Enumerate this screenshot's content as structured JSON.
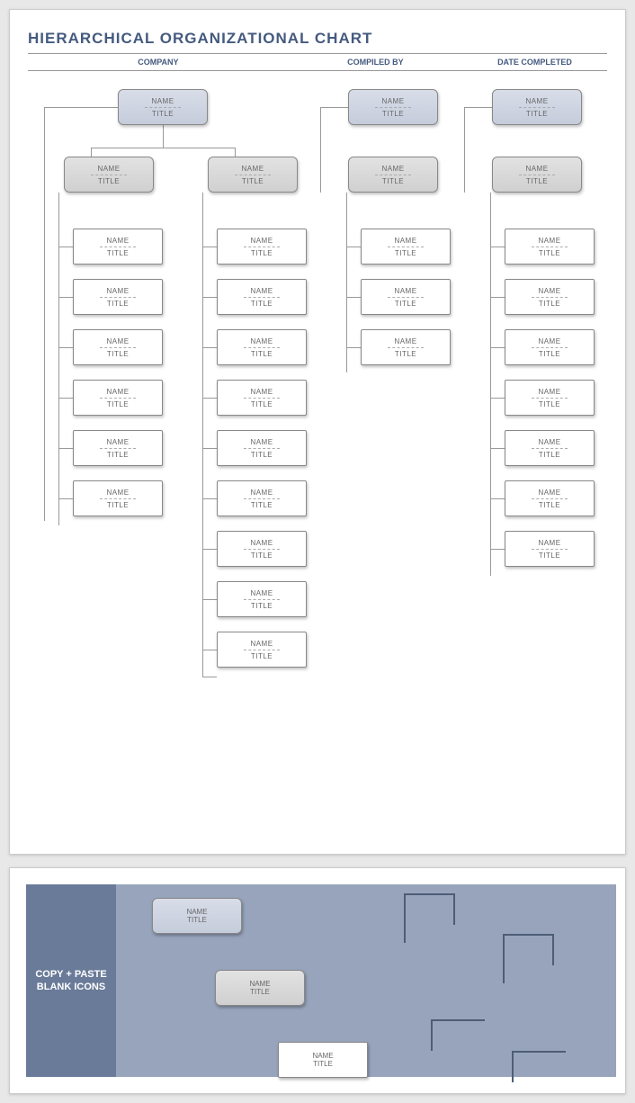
{
  "title": "HIERARCHICAL ORGANIZATIONAL CHART",
  "headers": {
    "company": "COMPANY",
    "compiled": "COMPILED BY",
    "date": "DATE COMPLETED"
  },
  "node": {
    "name": "NAME",
    "title": "TITLE"
  },
  "palette_label": "COPY + PASTE BLANK ICONS",
  "chart_data": {
    "type": "tree",
    "description": "Hierarchical org chart template with placeholder boxes",
    "nodes": [
      {
        "id": "root1",
        "name": "NAME",
        "title": "TITLE",
        "level": 0,
        "children": [
          {
            "id": "mid1",
            "name": "NAME",
            "title": "TITLE",
            "level": 1,
            "child_count": 6
          },
          {
            "id": "mid2",
            "name": "NAME",
            "title": "TITLE",
            "level": 1,
            "child_count": 9
          }
        ]
      },
      {
        "id": "root2",
        "name": "NAME",
        "title": "TITLE",
        "level": 0,
        "children": [
          {
            "id": "mid3",
            "name": "NAME",
            "title": "TITLE",
            "level": 1,
            "child_count": 3
          }
        ]
      },
      {
        "id": "root3",
        "name": "NAME",
        "title": "TITLE",
        "level": 0,
        "children": [
          {
            "id": "mid4",
            "name": "NAME",
            "title": "TITLE",
            "level": 1,
            "child_count": 7
          }
        ]
      }
    ]
  }
}
